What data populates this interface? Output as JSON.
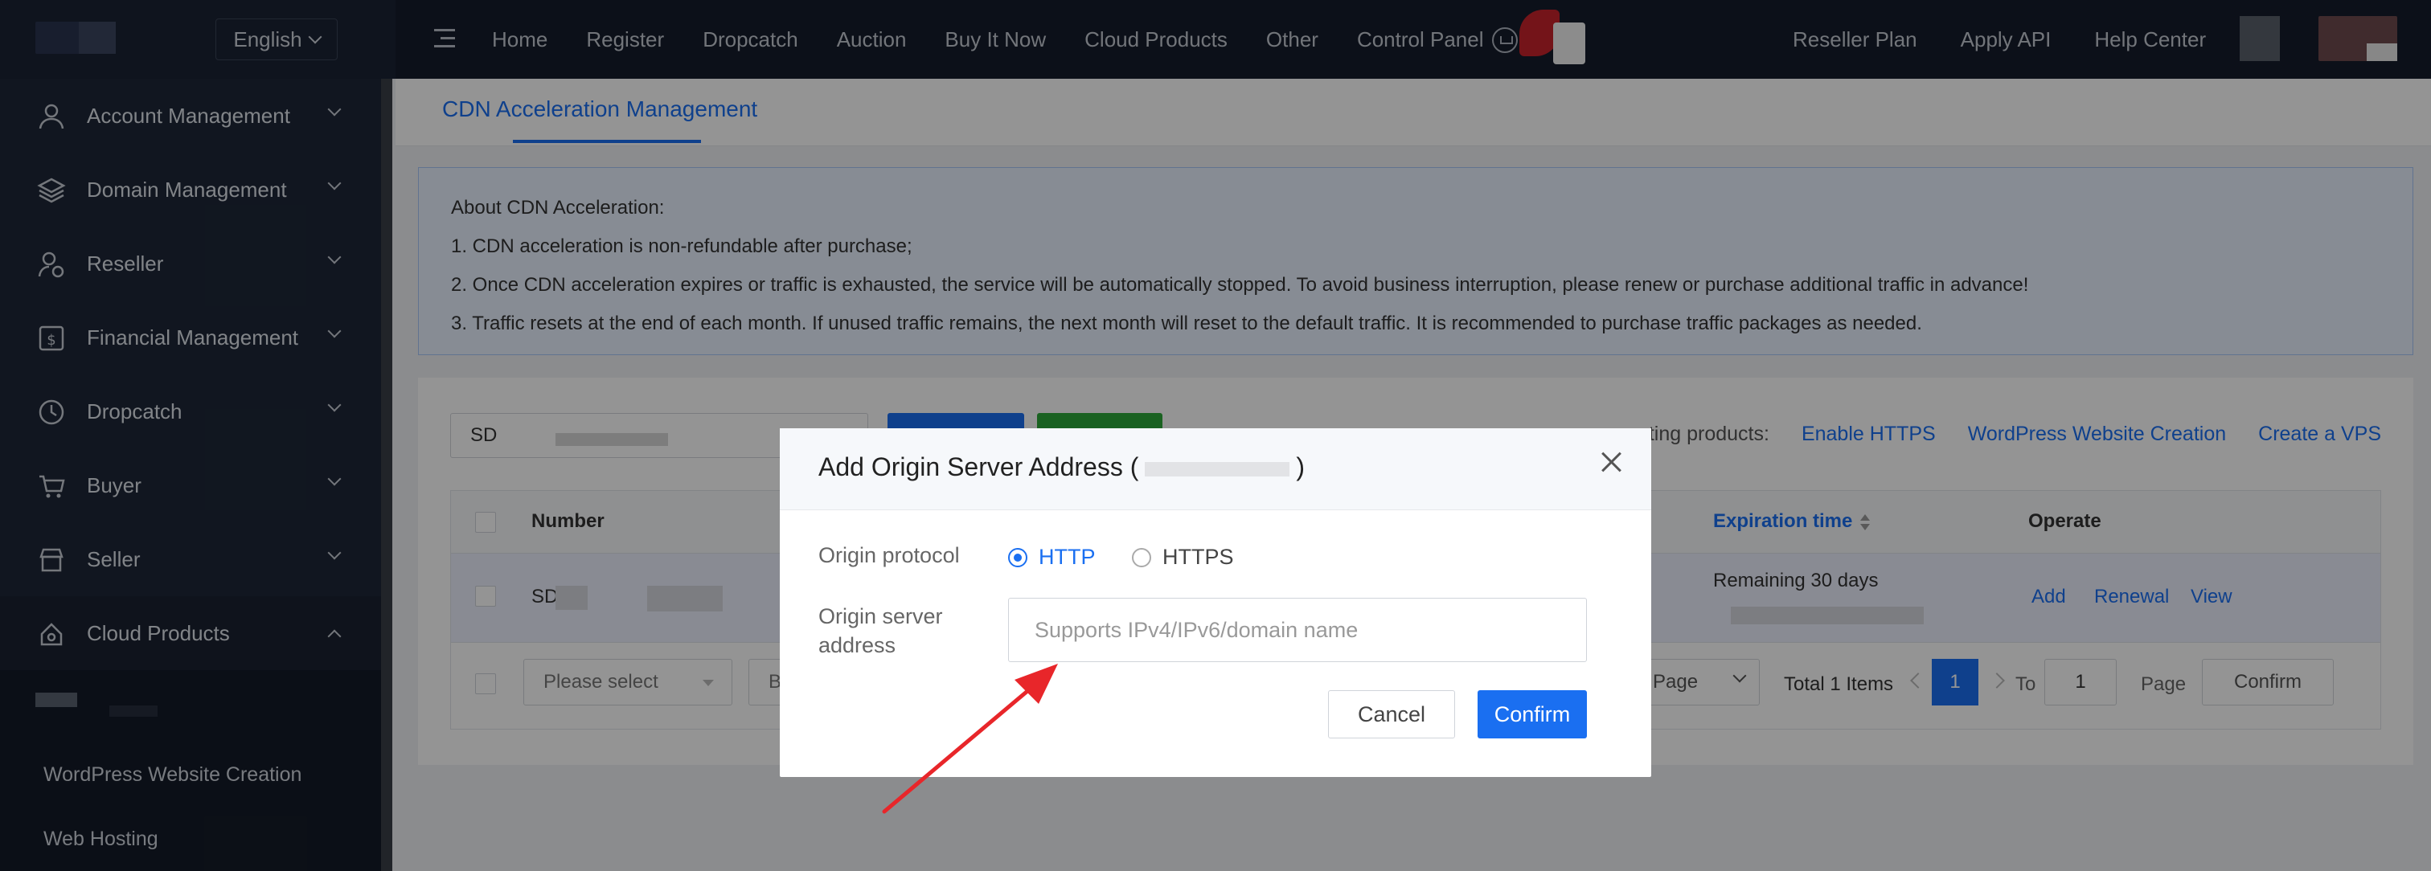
{
  "header": {
    "language": "English",
    "nav": [
      "Home",
      "Register",
      "Dropcatch",
      "Auction",
      "Buy It Now",
      "Cloud Products",
      "Other",
      "Control Panel"
    ],
    "right_nav": [
      "Reseller Plan",
      "Apply API",
      "Help Center"
    ]
  },
  "sidebar": {
    "items": [
      {
        "label": "Account Management",
        "icon": "user-icon"
      },
      {
        "label": "Domain Management",
        "icon": "layers-icon"
      },
      {
        "label": "Reseller",
        "icon": "reseller-icon"
      },
      {
        "label": "Financial Management",
        "icon": "dollar-icon"
      },
      {
        "label": "Dropcatch",
        "icon": "clock-icon"
      },
      {
        "label": "Buyer",
        "icon": "cart-icon"
      },
      {
        "label": "Seller",
        "icon": "store-icon"
      },
      {
        "label": "Cloud Products",
        "icon": "cloud-icon"
      }
    ],
    "submenu": [
      "WordPress Website Creation",
      "Web Hosting"
    ]
  },
  "tab": {
    "active": "CDN Acceleration Management"
  },
  "notice": {
    "title": "About CDN Acceleration:",
    "lines": [
      "1. CDN acceleration is non-refundable after purchase;",
      "2. Once CDN acceleration expires or traffic is exhausted, the service will be automatically stopped. To avoid business interruption, please renew or purchase additional traffic in advance!",
      "3. Traffic resets at the end of each month. If unused traffic remains, the next month will reset to the default traffic. It is recommended to purchase traffic packages as needed."
    ]
  },
  "toolbar": {
    "search_value": "SD",
    "supporting_label": "rting products:",
    "links": [
      "Enable HTTPS",
      "WordPress Website Creation",
      "Create a VPS"
    ]
  },
  "table": {
    "columns": {
      "number": "Number",
      "expiration": "Expiration time",
      "operate": "Operate"
    },
    "row": {
      "number": "SD",
      "expiration": "Remaining 30 days",
      "actions": [
        "Add",
        "Renewal",
        "View"
      ]
    }
  },
  "footer": {
    "select_placeholder": "Please select",
    "select_partial": "B",
    "page_size_label": "Page",
    "total": "Total 1 Items",
    "current_page": "1",
    "to_label": "To",
    "goto_value": "1",
    "page_label": "Page",
    "confirm": "Confirm"
  },
  "modal": {
    "title_prefix": "Add Origin Server Address (",
    "title_suffix": ")",
    "protocol_label": "Origin protocol",
    "protocol_options": [
      "HTTP",
      "HTTPS"
    ],
    "selected_protocol": "HTTP",
    "address_label_line1": "Origin server",
    "address_label_line2": "address",
    "address_placeholder": "Supports IPv4/IPv6/domain name",
    "cancel": "Cancel",
    "confirm": "Confirm"
  },
  "colors": {
    "accent": "#1a6ff1",
    "annotation_arrow": "#e8262a",
    "sidebar": "#1e2737",
    "topbar": "#161d2b"
  }
}
